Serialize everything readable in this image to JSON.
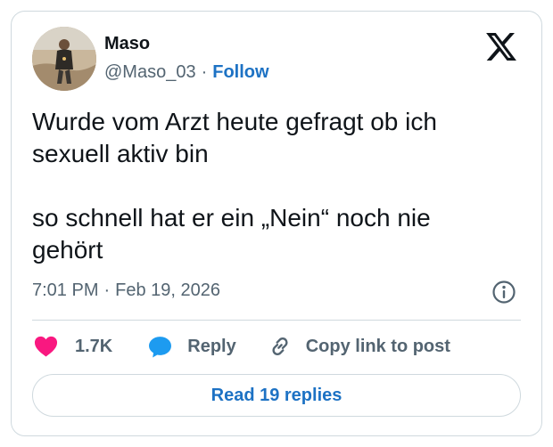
{
  "author": {
    "display_name": "Maso",
    "handle": "@Maso_03",
    "separator": "·",
    "follow_label": "Follow"
  },
  "tweet": {
    "text": "Wurde vom Arzt heute gefragt ob ich\nsexuell aktiv bin\n\nso schnell hat er ein „Nein“ noch nie\ngehört",
    "time": "7:01 PM",
    "separator": "·",
    "date": "Feb 19, 2026"
  },
  "actions": {
    "like_count": "1.7K",
    "reply_label": "Reply",
    "copy_link_label": "Copy link to post"
  },
  "read_replies_label": "Read 19 replies",
  "icons": {
    "logo": "x-logo-icon",
    "info": "info-icon",
    "like": "heart-icon",
    "reply": "speech-bubble-icon",
    "copy": "link-icon"
  },
  "colors": {
    "link": "#1d72c4",
    "heart": "#f91880",
    "reply_bubble": "#1d9bf0",
    "muted_text": "#536471",
    "border": "#cfd9de"
  }
}
